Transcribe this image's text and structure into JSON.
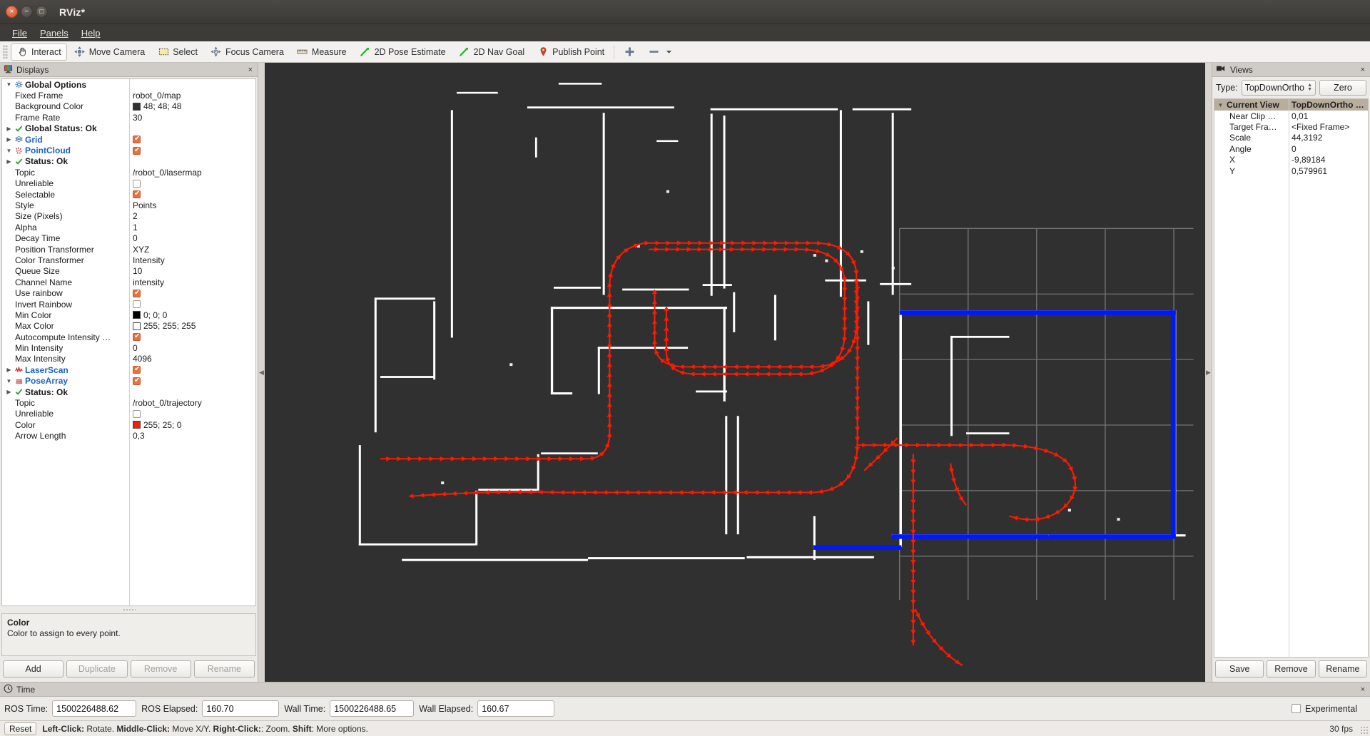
{
  "window": {
    "title": "RViz*",
    "buttons": {
      "close": "×",
      "minimize": "−",
      "maximize": "□"
    }
  },
  "menu": {
    "items": [
      "File",
      "Panels",
      "Help"
    ]
  },
  "toolbar": {
    "items": [
      {
        "label": "Interact",
        "icon": "hand-cursor-icon",
        "active": true
      },
      {
        "label": "Move Camera",
        "icon": "move-camera-icon",
        "active": false
      },
      {
        "label": "Select",
        "icon": "select-rect-icon",
        "active": false
      },
      {
        "label": "Focus Camera",
        "icon": "focus-camera-icon",
        "active": false
      },
      {
        "label": "Measure",
        "icon": "ruler-icon",
        "active": false
      },
      {
        "label": "2D Pose Estimate",
        "icon": "pose-arrow-icon",
        "active": false
      },
      {
        "label": "2D Nav Goal",
        "icon": "nav-arrow-icon",
        "active": false
      },
      {
        "label": "Publish Point",
        "icon": "map-pin-icon",
        "active": false
      }
    ],
    "extra_add_icon": "plus-tool-icon",
    "extra_menu_icon": "minus-dropdown-icon"
  },
  "displays": {
    "panel_title": "Displays",
    "panel_icon": "display-monitor-icon",
    "close_icon": "×",
    "rows": [
      {
        "indent": 1,
        "arrow": "open",
        "icon": "gear-icon",
        "label": "Global Options",
        "bold": true,
        "value": "",
        "vtype": "none"
      },
      {
        "indent": 2,
        "arrow": "none",
        "icon": "none",
        "label": "Fixed Frame",
        "value": "robot_0/map",
        "vtype": "text"
      },
      {
        "indent": 2,
        "arrow": "none",
        "icon": "none",
        "label": "Background Color",
        "value": "48; 48; 48",
        "vtype": "swatch",
        "color": "#303030"
      },
      {
        "indent": 2,
        "arrow": "none",
        "icon": "none",
        "label": "Frame Rate",
        "value": "30",
        "vtype": "text"
      },
      {
        "indent": 1,
        "arrow": "closed",
        "icon": "check-icon",
        "label": "Global Status: Ok",
        "bold": true,
        "value": "",
        "vtype": "none"
      },
      {
        "indent": 1,
        "arrow": "closed",
        "icon": "grid-icon",
        "label": "Grid",
        "blue": true,
        "value": "",
        "vtype": "check-on"
      },
      {
        "indent": 1,
        "arrow": "open",
        "icon": "pointcloud-icon",
        "label": "PointCloud",
        "blue": true,
        "value": "",
        "vtype": "check-on"
      },
      {
        "indent": 2,
        "arrow": "closed",
        "icon": "check-icon",
        "label": "Status: Ok",
        "bold": true,
        "value": "",
        "vtype": "none"
      },
      {
        "indent": 3,
        "arrow": "none",
        "icon": "none",
        "label": "Topic",
        "value": "/robot_0/lasermap",
        "vtype": "text"
      },
      {
        "indent": 3,
        "arrow": "none",
        "icon": "none",
        "label": "Unreliable",
        "value": "",
        "vtype": "check-off"
      },
      {
        "indent": 3,
        "arrow": "none",
        "icon": "none",
        "label": "Selectable",
        "value": "",
        "vtype": "check-on"
      },
      {
        "indent": 3,
        "arrow": "none",
        "icon": "none",
        "label": "Style",
        "value": "Points",
        "vtype": "text"
      },
      {
        "indent": 3,
        "arrow": "none",
        "icon": "none",
        "label": "Size (Pixels)",
        "value": "2",
        "vtype": "text"
      },
      {
        "indent": 3,
        "arrow": "none",
        "icon": "none",
        "label": "Alpha",
        "value": "1",
        "vtype": "text"
      },
      {
        "indent": 3,
        "arrow": "none",
        "icon": "none",
        "label": "Decay Time",
        "value": "0",
        "vtype": "text"
      },
      {
        "indent": 3,
        "arrow": "none",
        "icon": "none",
        "label": "Position Transformer",
        "value": "XYZ",
        "vtype": "text"
      },
      {
        "indent": 3,
        "arrow": "none",
        "icon": "none",
        "label": "Color Transformer",
        "value": "Intensity",
        "vtype": "text"
      },
      {
        "indent": 3,
        "arrow": "none",
        "icon": "none",
        "label": "Queue Size",
        "value": "10",
        "vtype": "text"
      },
      {
        "indent": 3,
        "arrow": "none",
        "icon": "none",
        "label": "Channel Name",
        "value": "intensity",
        "vtype": "text"
      },
      {
        "indent": 3,
        "arrow": "none",
        "icon": "none",
        "label": "Use rainbow",
        "value": "",
        "vtype": "check-on"
      },
      {
        "indent": 3,
        "arrow": "none",
        "icon": "none",
        "label": "Invert Rainbow",
        "value": "",
        "vtype": "check-off"
      },
      {
        "indent": 3,
        "arrow": "none",
        "icon": "none",
        "label": "Min Color",
        "value": "0; 0; 0",
        "vtype": "swatch",
        "color": "#000000"
      },
      {
        "indent": 3,
        "arrow": "none",
        "icon": "none",
        "label": "Max Color",
        "value": "255; 255; 255",
        "vtype": "swatch",
        "color": "#ffffff"
      },
      {
        "indent": 3,
        "arrow": "none",
        "icon": "none",
        "label": "Autocompute Intensity …",
        "value": "",
        "vtype": "check-on"
      },
      {
        "indent": 3,
        "arrow": "none",
        "icon": "none",
        "label": "Min Intensity",
        "value": "0",
        "vtype": "text"
      },
      {
        "indent": 3,
        "arrow": "none",
        "icon": "none",
        "label": "Max Intensity",
        "value": "4096",
        "vtype": "text"
      },
      {
        "indent": 1,
        "arrow": "closed",
        "icon": "laserscan-icon",
        "label": "LaserScan",
        "blue": true,
        "value": "",
        "vtype": "check-on"
      },
      {
        "indent": 1,
        "arrow": "open",
        "icon": "posearray-icon",
        "label": "PoseArray",
        "blue": true,
        "value": "",
        "vtype": "check-on"
      },
      {
        "indent": 2,
        "arrow": "closed",
        "icon": "check-icon",
        "label": "Status: Ok",
        "bold": true,
        "value": "",
        "vtype": "none"
      },
      {
        "indent": 3,
        "arrow": "none",
        "icon": "none",
        "label": "Topic",
        "value": "/robot_0/trajectory",
        "vtype": "text"
      },
      {
        "indent": 3,
        "arrow": "none",
        "icon": "none",
        "label": "Unreliable",
        "value": "",
        "vtype": "check-off"
      },
      {
        "indent": 3,
        "arrow": "none",
        "icon": "none",
        "label": "Color",
        "value": "255; 25; 0",
        "vtype": "swatch",
        "color": "#ff1900"
      },
      {
        "indent": 3,
        "arrow": "none",
        "icon": "none",
        "label": "Arrow Length",
        "value": "0,3",
        "vtype": "text"
      }
    ],
    "description": {
      "title": "Color",
      "text": "Color to assign to every point."
    },
    "buttons": [
      {
        "label": "Add",
        "enabled": true
      },
      {
        "label": "Duplicate",
        "enabled": false
      },
      {
        "label": "Remove",
        "enabled": false
      },
      {
        "label": "Rename",
        "enabled": false
      }
    ]
  },
  "views": {
    "panel_title": "Views",
    "panel_icon": "camera-icon",
    "close_icon": "×",
    "type_label": "Type:",
    "type_value": "TopDownOrtho",
    "zero_label": "Zero",
    "header": {
      "col1": "Current View",
      "col2": "TopDownOrtho …"
    },
    "rows": [
      {
        "label": "Near Clip …",
        "value": "0,01"
      },
      {
        "label": "Target Fra…",
        "value": "<Fixed Frame>"
      },
      {
        "label": "Scale",
        "value": "44,3192"
      },
      {
        "label": "Angle",
        "value": "0"
      },
      {
        "label": "X",
        "value": "-9,89184"
      },
      {
        "label": "Y",
        "value": "0,579961"
      }
    ],
    "buttons": [
      {
        "label": "Save"
      },
      {
        "label": "Remove"
      },
      {
        "label": "Rename"
      }
    ]
  },
  "time": {
    "panel_title": "Time",
    "panel_icon": "clock-icon",
    "close_icon": "×",
    "fields": [
      {
        "label": "ROS Time:",
        "value": "1500226488.62"
      },
      {
        "label": "ROS Elapsed:",
        "value": "160.70"
      },
      {
        "label": "Wall Time:",
        "value": "1500226488.65"
      },
      {
        "label": "Wall Elapsed:",
        "value": "160.67"
      }
    ],
    "experimental_label": "Experimental",
    "experimental_checked": false
  },
  "statusbar": {
    "reset_label": "Reset",
    "hint_parts": [
      {
        "t": "Left-Click:",
        "b": true
      },
      {
        "t": " Rotate. ",
        "b": false
      },
      {
        "t": "Middle-Click:",
        "b": true
      },
      {
        "t": " Move X/Y. ",
        "b": false
      },
      {
        "t": "Right-Click:",
        "b": true
      },
      {
        "t": ": Zoom. ",
        "b": false
      },
      {
        "t": "Shift",
        "b": true
      },
      {
        "t": ": More options.",
        "b": false
      }
    ],
    "fps": "30 fps"
  },
  "viewport": {
    "background_color": "#303030",
    "pointcloud_color": "#ffffff",
    "trajectory_color": "#ff1900",
    "laserscan_color": "#0018ff",
    "grid_color": "#8a8a8a"
  }
}
